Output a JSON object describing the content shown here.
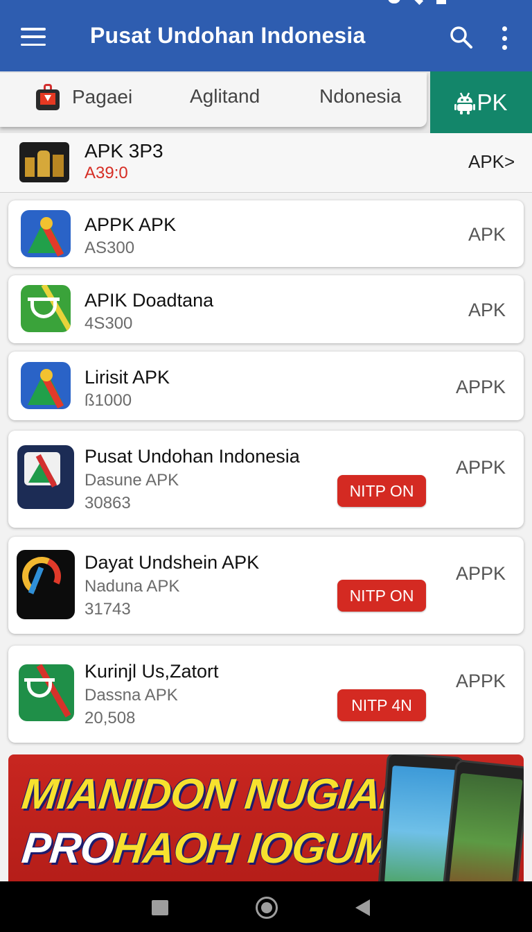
{
  "app_bar": {
    "title": "Pusat Undohan Indonesia",
    "icons": [
      "menu-icon",
      "search-icon",
      "more-vert-icon"
    ],
    "color": "#2e5db0"
  },
  "tabs": [
    {
      "label": "Pagaei",
      "icon": "tv-bag-icon"
    },
    {
      "label": "Aglitand"
    },
    {
      "label": "Ndonesia"
    },
    {
      "label": "PK",
      "icon": "android-icon",
      "active": true,
      "color": "#13866a"
    }
  ],
  "featured": {
    "title": "APK 3P3",
    "price": "A39:0",
    "apk_label": "APK",
    "chevron": ">"
  },
  "apps": [
    {
      "title": "APPK APK",
      "num": "AS300",
      "apk_label": "APK"
    },
    {
      "title": "APIK Doadtana",
      "num": "4S300",
      "apk_label": "APK"
    },
    {
      "title": "Lirisit APK",
      "num": "ß1000",
      "apk_label": "APPK"
    },
    {
      "title": "Pusat Undohan Indonesia",
      "subtitle": "Dasune APK",
      "num": "30863",
      "apk_label": "APPK",
      "button": "NITP ON"
    },
    {
      "title": "Dayat Undshein APK",
      "subtitle": "Naduna APK",
      "num": "31743",
      "apk_label": "APPK",
      "button": "NITP ON"
    },
    {
      "title": "Kurinjl Us,Zatort",
      "subtitle": "Dassna APK",
      "num": "20,508",
      "apk_label": "APPK",
      "button": "NITP 4N"
    }
  ],
  "banner": {
    "line1": "MIANIDON NUGIAN",
    "line2_a": "PRO",
    "line2_b": "HAOH IOGUM."
  },
  "colors": {
    "accent_red": "#d42a22",
    "banner_yellow": "#f7e12e"
  }
}
